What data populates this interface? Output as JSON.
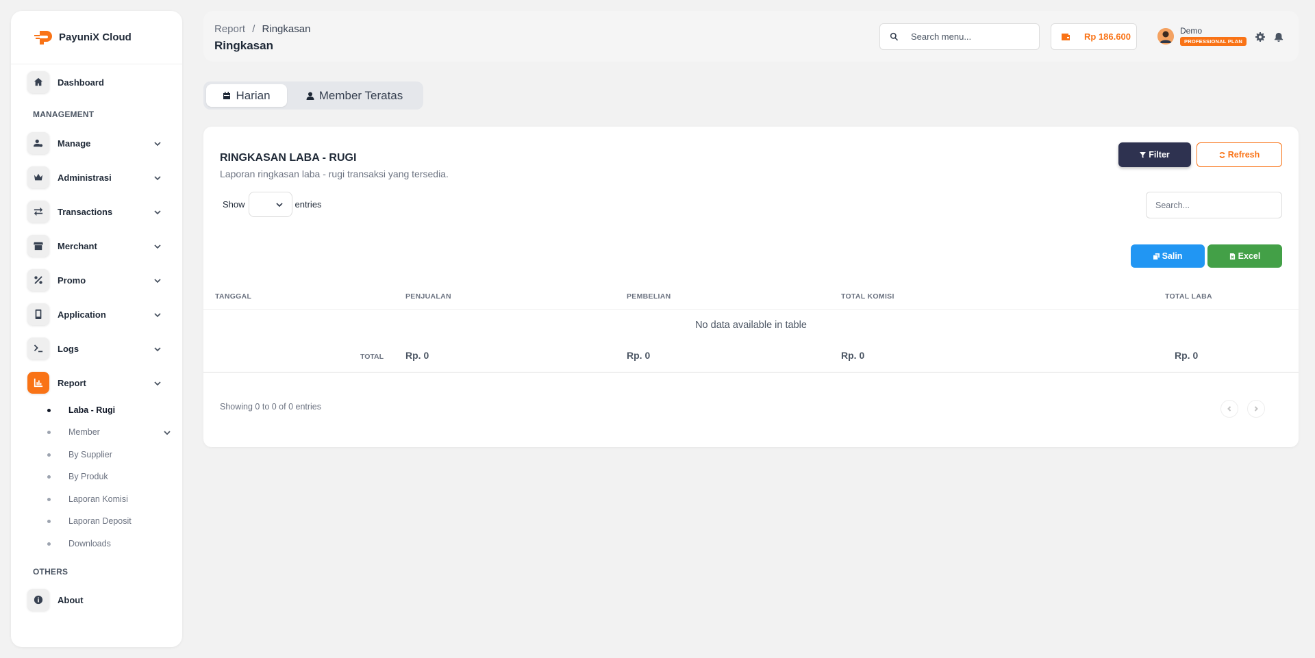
{
  "brand": {
    "name": "PayuniX Cloud"
  },
  "sidebar": {
    "dashboard": "Dashboard",
    "section_management": "MANAGEMENT",
    "items": [
      {
        "label": "Manage",
        "icon": "user-gear-icon"
      },
      {
        "label": "Administrasi",
        "icon": "crown-icon"
      },
      {
        "label": "Transactions",
        "icon": "arrows-exchange-icon"
      },
      {
        "label": "Merchant",
        "icon": "store-icon"
      },
      {
        "label": "Promo",
        "icon": "percent-icon"
      },
      {
        "label": "Application",
        "icon": "mobile-icon"
      },
      {
        "label": "Logs",
        "icon": "terminal-icon"
      },
      {
        "label": "Report",
        "icon": "chart-icon"
      }
    ],
    "report_sub": [
      "Laba - Rugi",
      "Member",
      "By Supplier",
      "By Produk",
      "Laporan Komisi",
      "Laporan Deposit",
      "Downloads"
    ],
    "section_others": "OTHERS",
    "about": "About"
  },
  "topbar": {
    "breadcrumb_parent": "Report",
    "breadcrumb_sep": "/",
    "breadcrumb_current": "Ringkasan",
    "page_title": "Ringkasan",
    "search_placeholder": "Search menu...",
    "balance": "Rp 186.600",
    "user_name": "Demo",
    "plan": "PROFESSIONAL PLAN"
  },
  "tabs": {
    "harian": "Harian",
    "member_teratas": "Member Teratas"
  },
  "card": {
    "title": "RINGKASAN LABA - RUGI",
    "subtitle": "Laporan ringkasan laba - rugi transaksi yang tersedia.",
    "filter": "Filter",
    "refresh": "Refresh",
    "show": "Show",
    "entries": "entries",
    "search_placeholder": "Search...",
    "salin": "Salin",
    "excel": "Excel",
    "columns": [
      "TANGGAL",
      "PENJUALAN",
      "PEMBELIAN",
      "TOTAL KOMISI",
      "TOTAL LABA"
    ],
    "no_data": "No data available in table",
    "total_label": "TOTAL",
    "totals": [
      "Rp. 0",
      "Rp. 0",
      "Rp. 0",
      "Rp. 0"
    ],
    "showing": "Showing 0 to 0 of 0 entries"
  },
  "colors": {
    "accent": "#f97316",
    "filter_btn": "#2e3250",
    "salin_btn": "#2196f3",
    "excel_btn": "#43a047"
  }
}
